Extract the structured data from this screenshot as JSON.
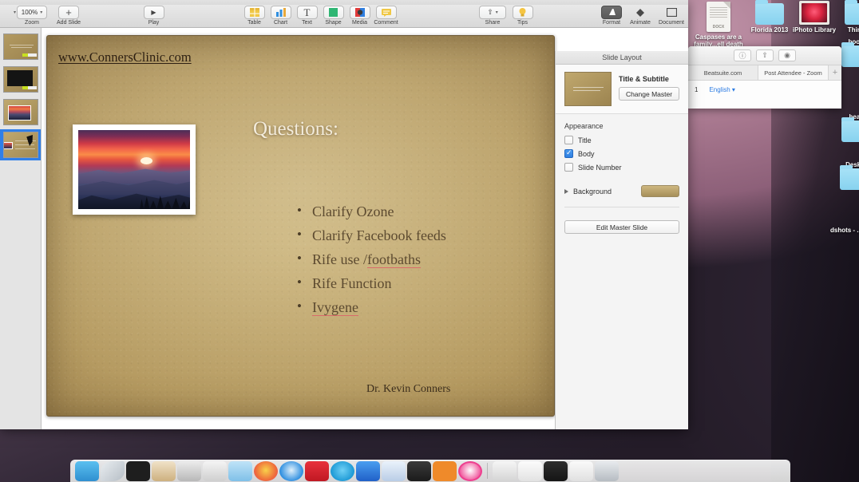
{
  "app": {
    "name": "Keynote",
    "window_title": ""
  },
  "toolbar": {
    "zoom_value": "100%",
    "zoom_label": "Zoom",
    "add_slide_label": "Add Slide",
    "play_label": "Play",
    "insert_items": [
      {
        "label": "Table",
        "icon": "table-icon"
      },
      {
        "label": "Chart",
        "icon": "chart-icon"
      },
      {
        "label": "Text",
        "icon": "text-icon"
      },
      {
        "label": "Shape",
        "icon": "shape-icon"
      },
      {
        "label": "Media",
        "icon": "media-icon"
      },
      {
        "label": "Comment",
        "icon": "comment-icon"
      }
    ],
    "share_label": "Share",
    "tips_label": "Tips",
    "view_items": [
      {
        "label": "Format",
        "icon": "format-icon",
        "active": true
      },
      {
        "label": "Animate",
        "icon": "animate-icon",
        "active": false
      },
      {
        "label": "Document",
        "icon": "document-icon",
        "active": false
      }
    ]
  },
  "navigator": {
    "slides": [
      {
        "index": "1",
        "type": "title",
        "selected": false
      },
      {
        "index": "2",
        "type": "dark-photo",
        "selected": false
      },
      {
        "index": "3",
        "type": "sunset-photo",
        "selected": false
      },
      {
        "index": "4",
        "type": "questions",
        "selected": true
      }
    ]
  },
  "slide": {
    "url": "www.ConnersClinic.com",
    "title": "Questions:",
    "bullets": [
      {
        "text": "Clarify Ozone",
        "misspelled": ""
      },
      {
        "text": "Clarify Facebook feeds",
        "misspelled": ""
      },
      {
        "text": "Rife use /",
        "misspelled": "footbaths"
      },
      {
        "text": "Rife Function",
        "misspelled": ""
      },
      {
        "text": "",
        "misspelled": "Ivygene"
      }
    ],
    "footer": "Dr. Kevin Conners",
    "photo_alt": "sunset-over-mountains"
  },
  "inspector": {
    "header": "Slide Layout",
    "master_name": "Title & Subtitle",
    "change_master_label": "Change Master",
    "appearance_label": "Appearance",
    "checkboxes": [
      {
        "label": "Title",
        "checked": false
      },
      {
        "label": "Body",
        "checked": true
      },
      {
        "label": "Slide Number",
        "checked": false
      }
    ],
    "background_label": "Background",
    "background_color": "#b89e68",
    "edit_master_label": "Edit Master Slide"
  },
  "browser": {
    "tabs": [
      {
        "label": "Beatsuite.com",
        "active": false
      },
      {
        "label": "Post Attendee - Zoom",
        "active": true
      }
    ],
    "new_tab_label": "+",
    "language_link": "English",
    "page_number": "1"
  },
  "desktop": {
    "icons": [
      {
        "label": "Caspases are a family...ell death",
        "type": "docx",
        "badge": "DOCX"
      },
      {
        "label": "Florida 2013",
        "type": "folder"
      },
      {
        "label": "iPhoto Library",
        "type": "photo"
      },
      {
        "label": "Think it",
        "type": "folder"
      },
      {
        "label": "book",
        "type": "folder"
      },
      {
        "label": "hear",
        "type": "folder"
      },
      {
        "label": "Deskt",
        "type": "folder"
      },
      {
        "label": "dshots - ...rs Cli",
        "type": "folder"
      }
    ]
  },
  "dock": {
    "items": [
      {
        "name": "finder",
        "color": "#3aa4e0"
      },
      {
        "name": "app-2",
        "color": "#cfd4d8"
      },
      {
        "name": "app-3",
        "color": "#262626"
      },
      {
        "name": "app-4",
        "color": "#d8b98a"
      },
      {
        "name": "app-5",
        "color": "#c9c9c9"
      },
      {
        "name": "app-6",
        "color": "#dedede"
      },
      {
        "name": "app-7",
        "color": "#a8d4ef"
      },
      {
        "name": "photos",
        "color": "#f2c14e"
      },
      {
        "name": "safari",
        "color": "#2f8fe0"
      },
      {
        "name": "keynote",
        "color": "#d9242e"
      },
      {
        "name": "skype",
        "color": "#2aaae0"
      },
      {
        "name": "messenger",
        "color": "#2f7fe8"
      },
      {
        "name": "word",
        "color": "#2b579a"
      },
      {
        "name": "app-14",
        "color": "#e8ecef"
      },
      {
        "name": "app-15",
        "color": "#3b3b3b"
      },
      {
        "name": "itunes",
        "color": "#f24d8e"
      },
      {
        "name": "app-17",
        "color": "#dcdcdc"
      },
      {
        "name": "app-18",
        "color": "#eeeeee"
      },
      {
        "name": "app-19",
        "color": "#333333"
      },
      {
        "name": "app-20",
        "color": "#f0f0f0"
      },
      {
        "name": "trash",
        "color": "#d4d7da"
      }
    ]
  }
}
